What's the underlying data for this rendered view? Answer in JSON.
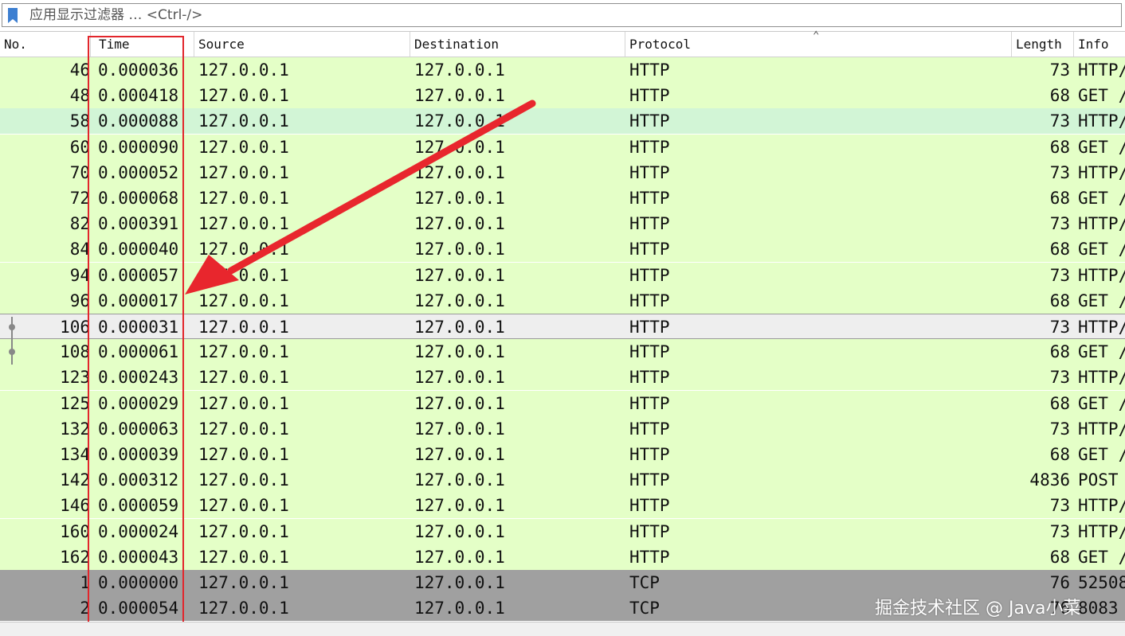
{
  "filter": {
    "placeholder": "应用显示过滤器 … <Ctrl-/>"
  },
  "columns": {
    "no": "No.",
    "time": "Time",
    "source": "Source",
    "destination": "Destination",
    "protocol": "Protocol",
    "length": "Length",
    "info": "Info"
  },
  "colors": {
    "http_row": "#e4ffc7",
    "http_row_alt": "#d2f5d6",
    "selected_row": "#eeeeee",
    "tcp_row": "#a0a0a0",
    "highlight": "#e2262c"
  },
  "packets": [
    {
      "no": "46",
      "time": "0.000036",
      "src": "127.0.0.1",
      "dst": "127.0.0.1",
      "proto": "HTTP",
      "len": "73",
      "info": "HTTP/",
      "style": "http"
    },
    {
      "no": "48",
      "time": "0.000418",
      "src": "127.0.0.1",
      "dst": "127.0.0.1",
      "proto": "HTTP",
      "len": "68",
      "info": "GET /",
      "style": "http"
    },
    {
      "no": "58",
      "time": "0.000088",
      "src": "127.0.0.1",
      "dst": "127.0.0.1",
      "proto": "HTTP",
      "len": "73",
      "info": "HTTP/",
      "style": "http-alt"
    },
    {
      "no": "60",
      "time": "0.000090",
      "src": "127.0.0.1",
      "dst": "127.0.0.1",
      "proto": "HTTP",
      "len": "68",
      "info": "GET /",
      "style": "http"
    },
    {
      "no": "70",
      "time": "0.000052",
      "src": "127.0.0.1",
      "dst": "127.0.0.1",
      "proto": "HTTP",
      "len": "73",
      "info": "HTTP/",
      "style": "http"
    },
    {
      "no": "72",
      "time": "0.000068",
      "src": "127.0.0.1",
      "dst": "127.0.0.1",
      "proto": "HTTP",
      "len": "68",
      "info": "GET /",
      "style": "http"
    },
    {
      "no": "82",
      "time": "0.000391",
      "src": "127.0.0.1",
      "dst": "127.0.0.1",
      "proto": "HTTP",
      "len": "73",
      "info": "HTTP/",
      "style": "http"
    },
    {
      "no": "84",
      "time": "0.000040",
      "src": "127.0.0.1",
      "dst": "127.0.0.1",
      "proto": "HTTP",
      "len": "68",
      "info": "GET /",
      "style": "http"
    },
    {
      "no": "94",
      "time": "0.000057",
      "src": "127.0.0.1",
      "dst": "127.0.0.1",
      "proto": "HTTP",
      "len": "73",
      "info": "HTTP/",
      "style": "http"
    },
    {
      "no": "96",
      "time": "0.000017",
      "src": "127.0.0.1",
      "dst": "127.0.0.1",
      "proto": "HTTP",
      "len": "68",
      "info": "GET /",
      "style": "http"
    },
    {
      "no": "106",
      "time": "0.000031",
      "src": "127.0.0.1",
      "dst": "127.0.0.1",
      "proto": "HTTP",
      "len": "73",
      "info": "HTTP/",
      "style": "selected"
    },
    {
      "no": "108",
      "time": "0.000061",
      "src": "127.0.0.1",
      "dst": "127.0.0.1",
      "proto": "HTTP",
      "len": "68",
      "info": "GET /",
      "style": "http"
    },
    {
      "no": "123",
      "time": "0.000243",
      "src": "127.0.0.1",
      "dst": "127.0.0.1",
      "proto": "HTTP",
      "len": "73",
      "info": "HTTP/",
      "style": "http"
    },
    {
      "no": "125",
      "time": "0.000029",
      "src": "127.0.0.1",
      "dst": "127.0.0.1",
      "proto": "HTTP",
      "len": "68",
      "info": "GET /",
      "style": "http"
    },
    {
      "no": "132",
      "time": "0.000063",
      "src": "127.0.0.1",
      "dst": "127.0.0.1",
      "proto": "HTTP",
      "len": "73",
      "info": "HTTP/",
      "style": "http"
    },
    {
      "no": "134",
      "time": "0.000039",
      "src": "127.0.0.1",
      "dst": "127.0.0.1",
      "proto": "HTTP",
      "len": "68",
      "info": "GET /",
      "style": "http"
    },
    {
      "no": "142",
      "time": "0.000312",
      "src": "127.0.0.1",
      "dst": "127.0.0.1",
      "proto": "HTTP",
      "len": "4836",
      "info": "POST",
      "style": "http"
    },
    {
      "no": "146",
      "time": "0.000059",
      "src": "127.0.0.1",
      "dst": "127.0.0.1",
      "proto": "HTTP",
      "len": "73",
      "info": "HTTP/",
      "style": "http"
    },
    {
      "no": "160",
      "time": "0.000024",
      "src": "127.0.0.1",
      "dst": "127.0.0.1",
      "proto": "HTTP",
      "len": "73",
      "info": "HTTP/",
      "style": "http"
    },
    {
      "no": "162",
      "time": "0.000043",
      "src": "127.0.0.1",
      "dst": "127.0.0.1",
      "proto": "HTTP",
      "len": "68",
      "info": "GET /",
      "style": "http"
    },
    {
      "no": "1",
      "time": "0.000000",
      "src": "127.0.0.1",
      "dst": "127.0.0.1",
      "proto": "TCP",
      "len": "76",
      "info": "52508",
      "style": "tcp"
    },
    {
      "no": "2",
      "time": "0.000054",
      "src": "127.0.0.1",
      "dst": "127.0.0.1",
      "proto": "TCP",
      "len": "76",
      "info": "8083",
      "style": "tcp"
    }
  ],
  "watermark": "掘金技术社区 @ Java小菜"
}
